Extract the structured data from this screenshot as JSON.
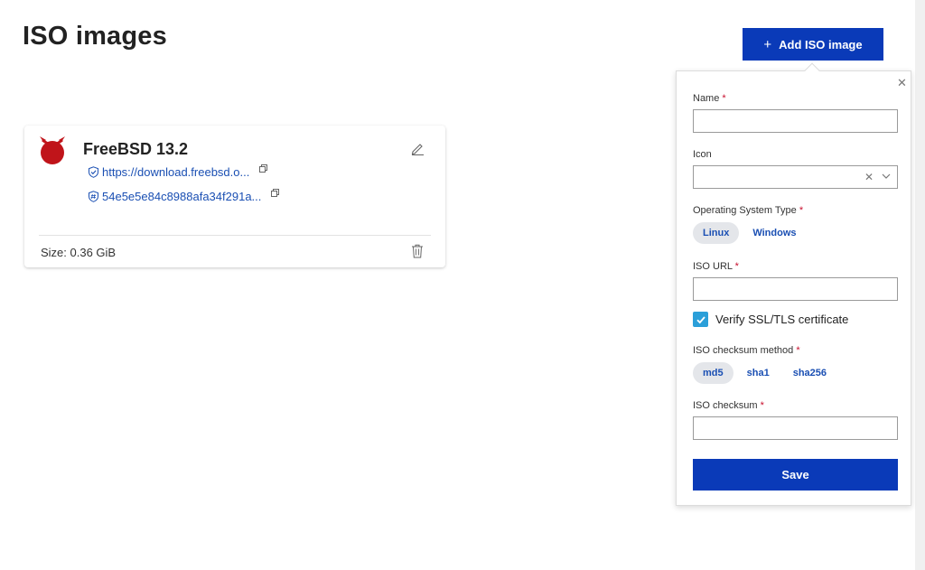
{
  "page": {
    "title": "ISO images"
  },
  "toolbar": {
    "add_label": "Add ISO image",
    "add_icon": "plus-icon"
  },
  "card": {
    "name": "FreeBSD 13.2",
    "url": "https://download.freebsd.o...",
    "checksum": "54e5e5e84c8988afa34f291a...",
    "size": "Size: 0.36 GiB",
    "logo_icon": "freebsd-logo-icon",
    "accent_color": "#c0141a"
  },
  "form": {
    "name_label": "Name",
    "name_value": "",
    "icon_label": "Icon",
    "icon_value": "",
    "os_type_label": "Operating System Type",
    "os_options": [
      "Linux",
      "Windows"
    ],
    "os_selected": "Linux",
    "iso_url_label": "ISO URL",
    "iso_url_value": "",
    "verify_label": "Verify SSL/TLS certificate",
    "verify_checked": true,
    "checksum_method_label": "ISO checksum method",
    "checksum_methods": [
      "md5",
      "sha1",
      "sha256"
    ],
    "checksum_method_selected": "md5",
    "checksum_label": "ISO checksum",
    "checksum_value": "",
    "required_mark": "*",
    "save_label": "Save"
  },
  "colors": {
    "primary": "#0a3ab8",
    "link": "#1a4fb3",
    "required": "#c8102e",
    "checkbox": "#2b9fd9"
  }
}
